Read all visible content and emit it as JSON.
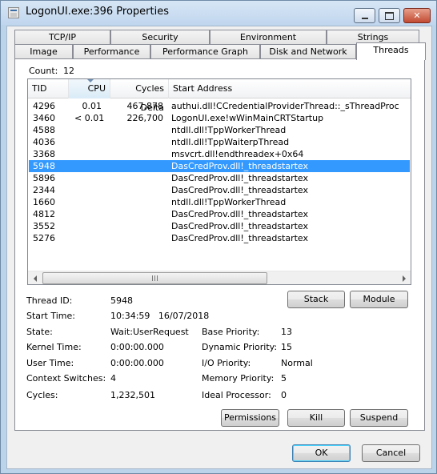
{
  "window": {
    "title": "LogonUI.exe:396 Properties"
  },
  "tabs_row1": [
    "TCP/IP",
    "Security",
    "Environment",
    "Strings"
  ],
  "tabs_row2": [
    "Image",
    "Performance",
    "Performance Graph",
    "Disk and Network",
    "Threads"
  ],
  "active_tab": "Threads",
  "count": {
    "label": "Count:",
    "value": "12"
  },
  "columns": [
    "TID",
    "CPU",
    "Cycles Delta",
    "Start Address"
  ],
  "sorted_column": "CPU",
  "threads": [
    {
      "tid": "4296",
      "cpu": "0.01",
      "cycles": "467,878",
      "address": "authui.dll!CCredentialProviderThread::_sThreadProc"
    },
    {
      "tid": "3460",
      "cpu": "< 0.01",
      "cycles": "226,700",
      "address": "LogonUI.exe!wWinMainCRTStartup"
    },
    {
      "tid": "4588",
      "cpu": "",
      "cycles": "",
      "address": "ntdll.dll!TppWorkerThread"
    },
    {
      "tid": "4036",
      "cpu": "",
      "cycles": "",
      "address": "ntdll.dll!TppWaiterpThread"
    },
    {
      "tid": "3368",
      "cpu": "",
      "cycles": "",
      "address": "msvcrt.dll!endthreadex+0x64"
    },
    {
      "tid": "5948",
      "cpu": "",
      "cycles": "",
      "address": "DasCredProv.dll!_threadstartex"
    },
    {
      "tid": "5896",
      "cpu": "",
      "cycles": "",
      "address": "DasCredProv.dll!_threadstartex"
    },
    {
      "tid": "2344",
      "cpu": "",
      "cycles": "",
      "address": "DasCredProv.dll!_threadstartex"
    },
    {
      "tid": "1660",
      "cpu": "",
      "cycles": "",
      "address": "ntdll.dll!TppWorkerThread"
    },
    {
      "tid": "4812",
      "cpu": "",
      "cycles": "",
      "address": "DasCredProv.dll!_threadstartex"
    },
    {
      "tid": "3552",
      "cpu": "",
      "cycles": "",
      "address": "DasCredProv.dll!_threadstartex"
    },
    {
      "tid": "5276",
      "cpu": "",
      "cycles": "",
      "address": "DasCredProv.dll!_threadstartex"
    }
  ],
  "selected_tid": "5948",
  "details": {
    "thread_id_label": "Thread ID:",
    "thread_id": "5948",
    "start_time_label": "Start Time:",
    "start_time": "10:34:59   16/07/2018",
    "state_label": "State:",
    "state": "Wait:UserRequest",
    "base_priority_label": "Base Priority:",
    "base_priority": "13",
    "kernel_time_label": "Kernel Time:",
    "kernel_time": "0:00:00.000",
    "dynamic_priority_label": "Dynamic Priority:",
    "dynamic_priority": "15",
    "user_time_label": "User Time:",
    "user_time": "0:00:00.000",
    "io_priority_label": "I/O Priority:",
    "io_priority": "Normal",
    "context_switches_label": "Context Switches:",
    "context_switches": "4",
    "memory_priority_label": "Memory Priority:",
    "memory_priority": "5",
    "cycles_label": "Cycles:",
    "cycles": "1,232,501",
    "ideal_processor_label": "Ideal Processor:",
    "ideal_processor": "0"
  },
  "buttons": {
    "stack": "Stack",
    "module": "Module",
    "permissions": "Permissions",
    "kill": "Kill",
    "suspend": "Suspend",
    "ok": "OK",
    "cancel": "Cancel"
  },
  "colors": {
    "selection": "#3399ff",
    "frame": "#bcd4ea"
  },
  "icons": {
    "app": "window-app-icon",
    "minimize": "minimize-icon",
    "maximize": "maximize-icon",
    "close": "close-icon"
  }
}
